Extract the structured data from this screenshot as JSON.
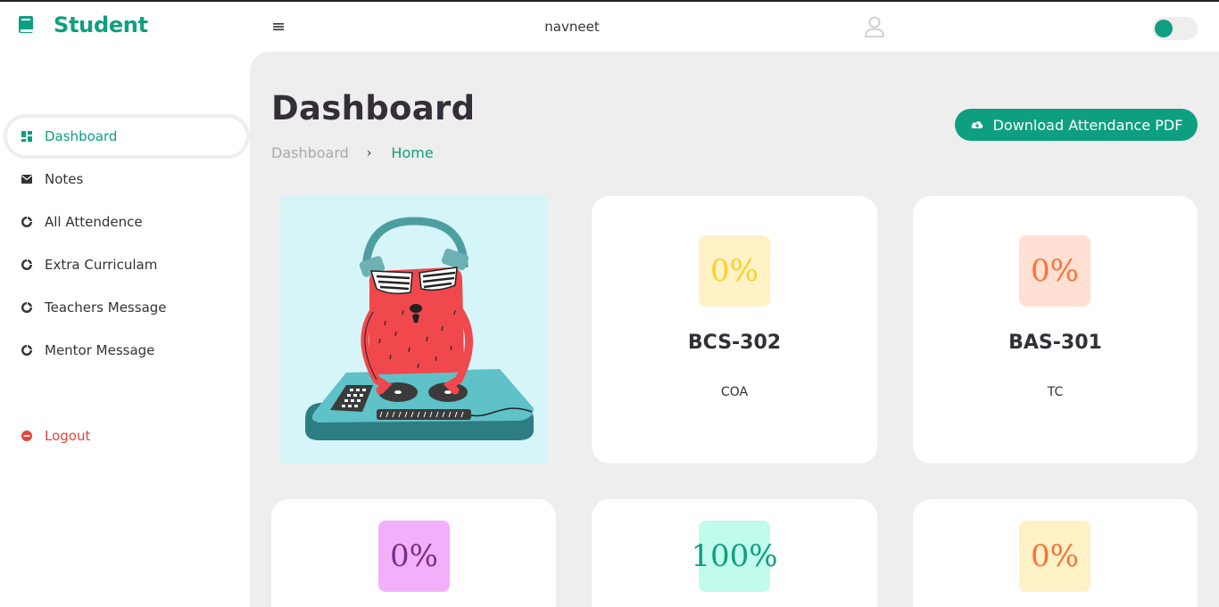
{
  "brand": {
    "name": "Student",
    "icon": "book-icon",
    "color": "#0e9f80"
  },
  "header": {
    "username": "navneet",
    "avatar_icon": "user-icon",
    "theme_toggle": "on"
  },
  "sidebar": {
    "items": [
      {
        "label": "Dashboard",
        "icon": "grid-icon",
        "active": true
      },
      {
        "label": "Notes",
        "icon": "envelope-icon"
      },
      {
        "label": "All Attendence",
        "icon": "pie-chart-icon"
      },
      {
        "label": "Extra Curriculam",
        "icon": "pie-chart-icon"
      },
      {
        "label": "Teachers Message",
        "icon": "pie-chart-icon"
      },
      {
        "label": "Mentor Message",
        "icon": "pie-chart-icon"
      }
    ],
    "logout": {
      "label": "Logout",
      "icon": "logout-icon"
    }
  },
  "main": {
    "title": "Dashboard",
    "breadcrumb": [
      "Dashboard",
      "Home"
    ],
    "download_button": "Download Attendance PDF"
  },
  "cards": [
    {
      "percent": "0%",
      "code": "BCS-302",
      "name": "COA",
      "badge_bg": "#fff2c6",
      "badge_fg": "#ffce26"
    },
    {
      "percent": "0%",
      "code": "BAS-301",
      "name": "TC",
      "badge_bg": "#ffe0d3",
      "badge_fg": "#fd7238"
    },
    {
      "percent": "0%",
      "code": "",
      "name": "",
      "badge_bg": "#f2b0fb",
      "badge_fg": "#7a2e8c"
    },
    {
      "percent": "100%",
      "code": "",
      "name": "",
      "badge_bg": "#c0fbec",
      "badge_fg": "#0e9f80"
    },
    {
      "percent": "0%",
      "code": "",
      "name": "",
      "badge_bg": "#fff2c6",
      "badge_fg": "#fd7238"
    }
  ]
}
